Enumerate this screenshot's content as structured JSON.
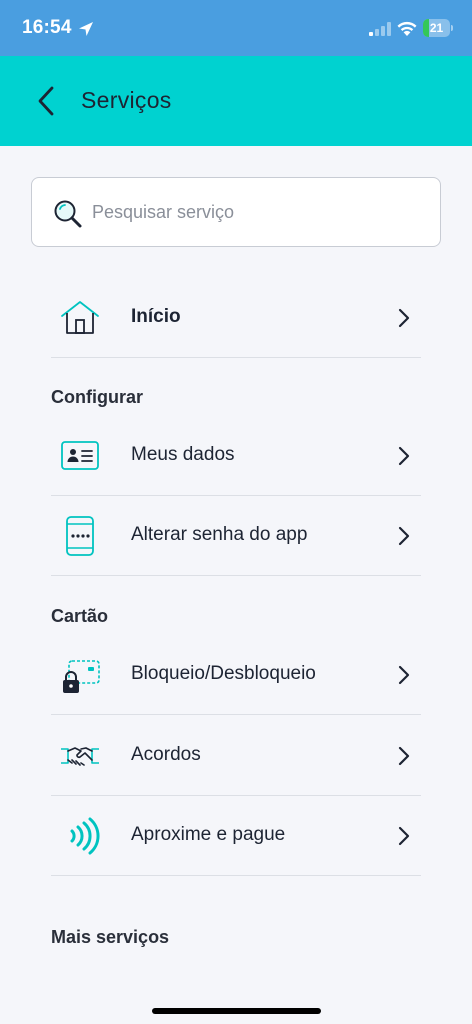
{
  "status_bar": {
    "time": "16:54",
    "battery_text": "21",
    "battery_level": 0.21,
    "icons": [
      "location-arrow-icon",
      "cellular-signal-icon",
      "wifi-icon",
      "battery-charging-icon"
    ]
  },
  "header": {
    "title": "Serviços",
    "back_icon": "chevron-left-icon",
    "background_color": "#00d2d0"
  },
  "search": {
    "placeholder": "Pesquisar serviço",
    "value": "",
    "icon": "search-icon"
  },
  "home_item": {
    "label": "Início",
    "icon": "home-icon"
  },
  "sections": [
    {
      "title": "Configurar",
      "items": [
        {
          "label": "Meus dados",
          "icon": "id-card-icon"
        },
        {
          "label": "Alterar senha do app",
          "icon": "phone-password-icon"
        }
      ]
    },
    {
      "title": "Cartão",
      "items": [
        {
          "label": "Bloqueio/Desbloqueio",
          "icon": "card-lock-icon"
        },
        {
          "label": "Acordos",
          "icon": "handshake-icon"
        },
        {
          "label": "Aproxime e pague",
          "icon": "contactless-icon"
        }
      ]
    },
    {
      "title": "Mais serviços",
      "items": []
    }
  ],
  "colors": {
    "accent": "#00c3c0",
    "text": "#1d2433",
    "status_bar": "#4a9ee0"
  }
}
